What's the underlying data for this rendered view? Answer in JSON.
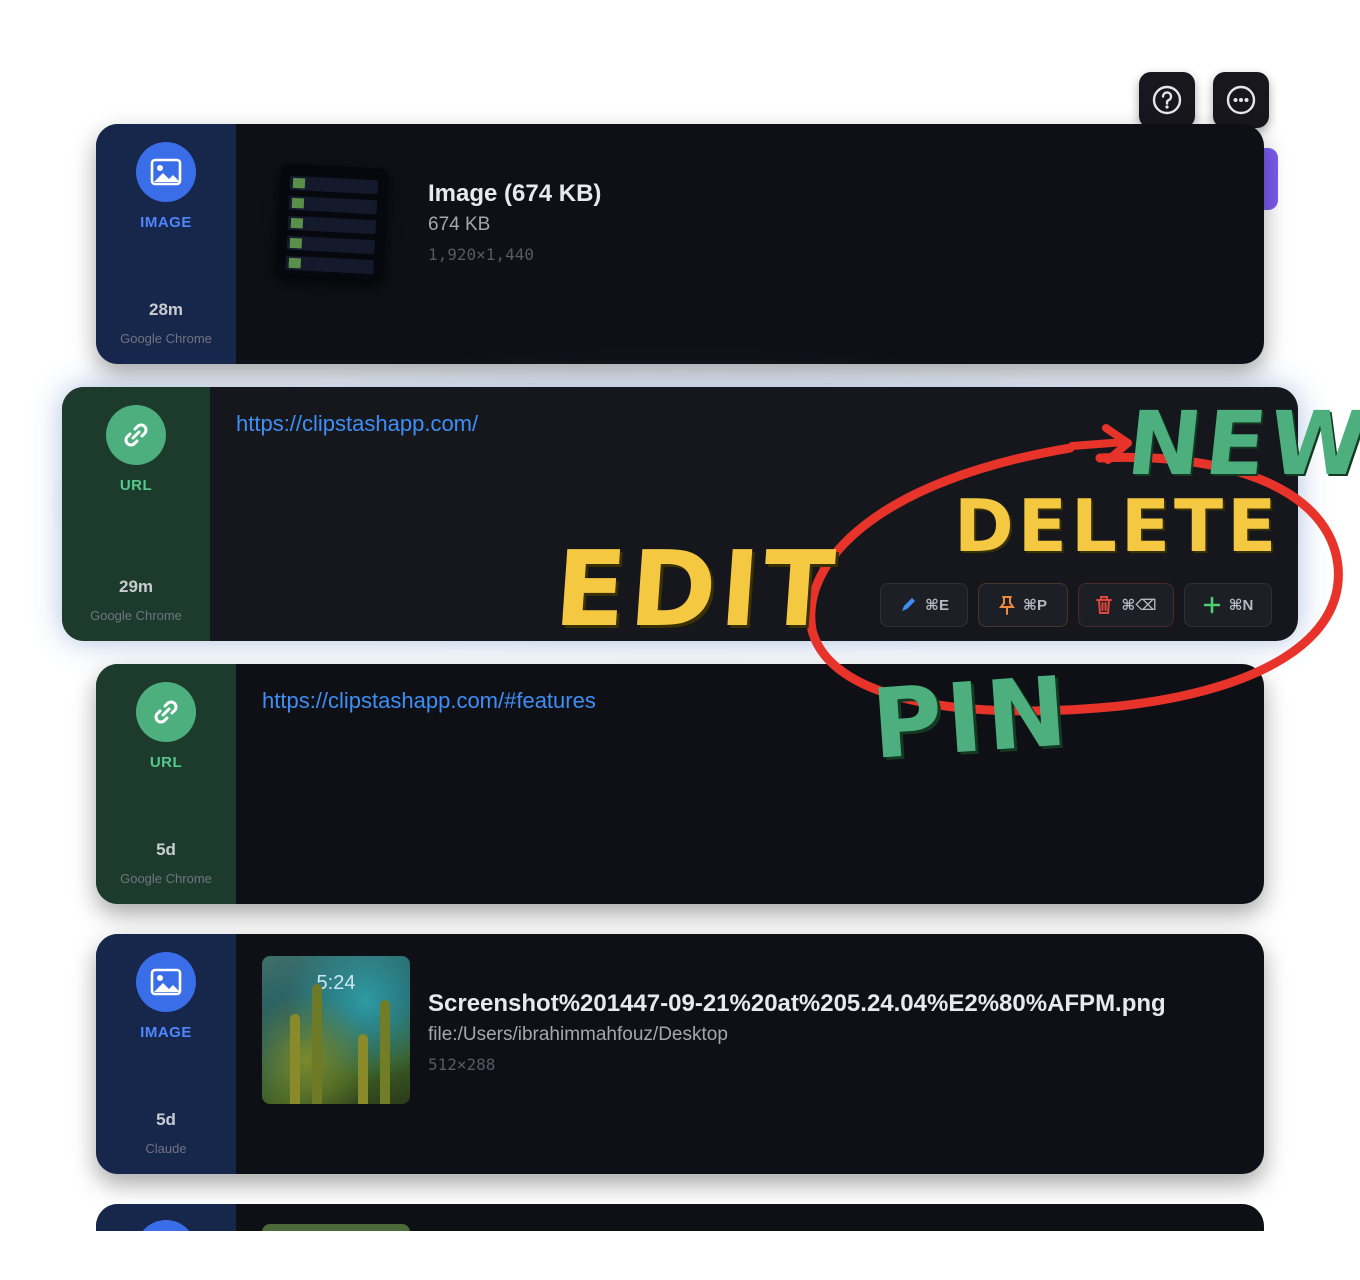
{
  "toolbar": {
    "help_icon": "question-circle-icon",
    "more_icon": "ellipsis-circle-icon"
  },
  "clips": [
    {
      "type_label": "IMAGE",
      "age": "28m",
      "source": "Google Chrome",
      "title": "Image (674 KB)",
      "subtitle": "674 KB",
      "dims": "1,920×1,440"
    },
    {
      "type_label": "URL",
      "age": "29m",
      "source": "Google Chrome",
      "url": "https://clipstashapp.com/"
    },
    {
      "type_label": "URL",
      "age": "5d",
      "source": "Google Chrome",
      "url": "https://clipstashapp.com/#features"
    },
    {
      "type_label": "IMAGE",
      "age": "5d",
      "source": "Claude",
      "title": "Screenshot%201447-09-21%20at%205.24.04%E2%80%AFPM.png",
      "subtitle": "file:/Users/ibrahimmahfouz/Desktop",
      "dims": "512×288",
      "thumb_clock": "5:24"
    }
  ],
  "actions": [
    {
      "icon": "pencil-icon",
      "shortcut": "⌘E",
      "color": "#3d8ff5"
    },
    {
      "icon": "pin-icon",
      "shortcut": "⌘P",
      "color": "#f08a3c"
    },
    {
      "icon": "trash-icon",
      "shortcut": "⌘⌫",
      "color": "#e5453a"
    },
    {
      "icon": "plus-icon",
      "shortcut": "⌘N",
      "color": "#4ccf6e"
    }
  ],
  "annotations": {
    "edit": "EDIT",
    "delete": "DELETE",
    "new": "NEW",
    "pin": "PIN"
  },
  "colors": {
    "image_accent": "#3a6ee8",
    "url_accent": "#4caf7d",
    "annotation_yellow": "#f5c842",
    "annotation_green": "#4caf7d",
    "annotation_red": "#e8332b",
    "card_bg": "#0f1016"
  }
}
